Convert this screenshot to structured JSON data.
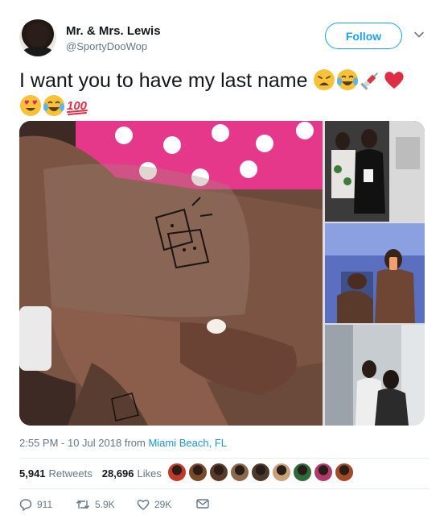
{
  "tweet": {
    "display_name": "Mr. & Mrs. Lewis",
    "handle": "@SportyDooWop",
    "follow_label": "Follow",
    "text": "I want you to have my last name",
    "emojis_line1": [
      "weary-face",
      "tears-of-joy-face",
      "syringe",
      "red-heart"
    ],
    "emojis_line2": [
      "heart-eyes-face",
      "tears-of-joy-face",
      "hundred-points"
    ],
    "time": "2:55 PM - 10 Jul 2018",
    "from_word": "from",
    "location": "Miami Beach, FL"
  },
  "stats": {
    "retweets_count": "5,941",
    "retweets_label": "Retweets",
    "likes_count": "28,696",
    "likes_label": "Likes",
    "liker_colors": [
      "#c0392b",
      "#7a4a2a",
      "#5b3a29",
      "#8a6a4a",
      "#4a3a2a",
      "#c7a27a",
      "#2e6b3a",
      "#b03a6a",
      "#a04a2a"
    ]
  },
  "actions": {
    "replies": "911",
    "retweets": "5.9K",
    "likes": "29K"
  },
  "colors": {
    "accent": "#1da1f2",
    "link": "#1b95e0",
    "muted": "#657786"
  }
}
